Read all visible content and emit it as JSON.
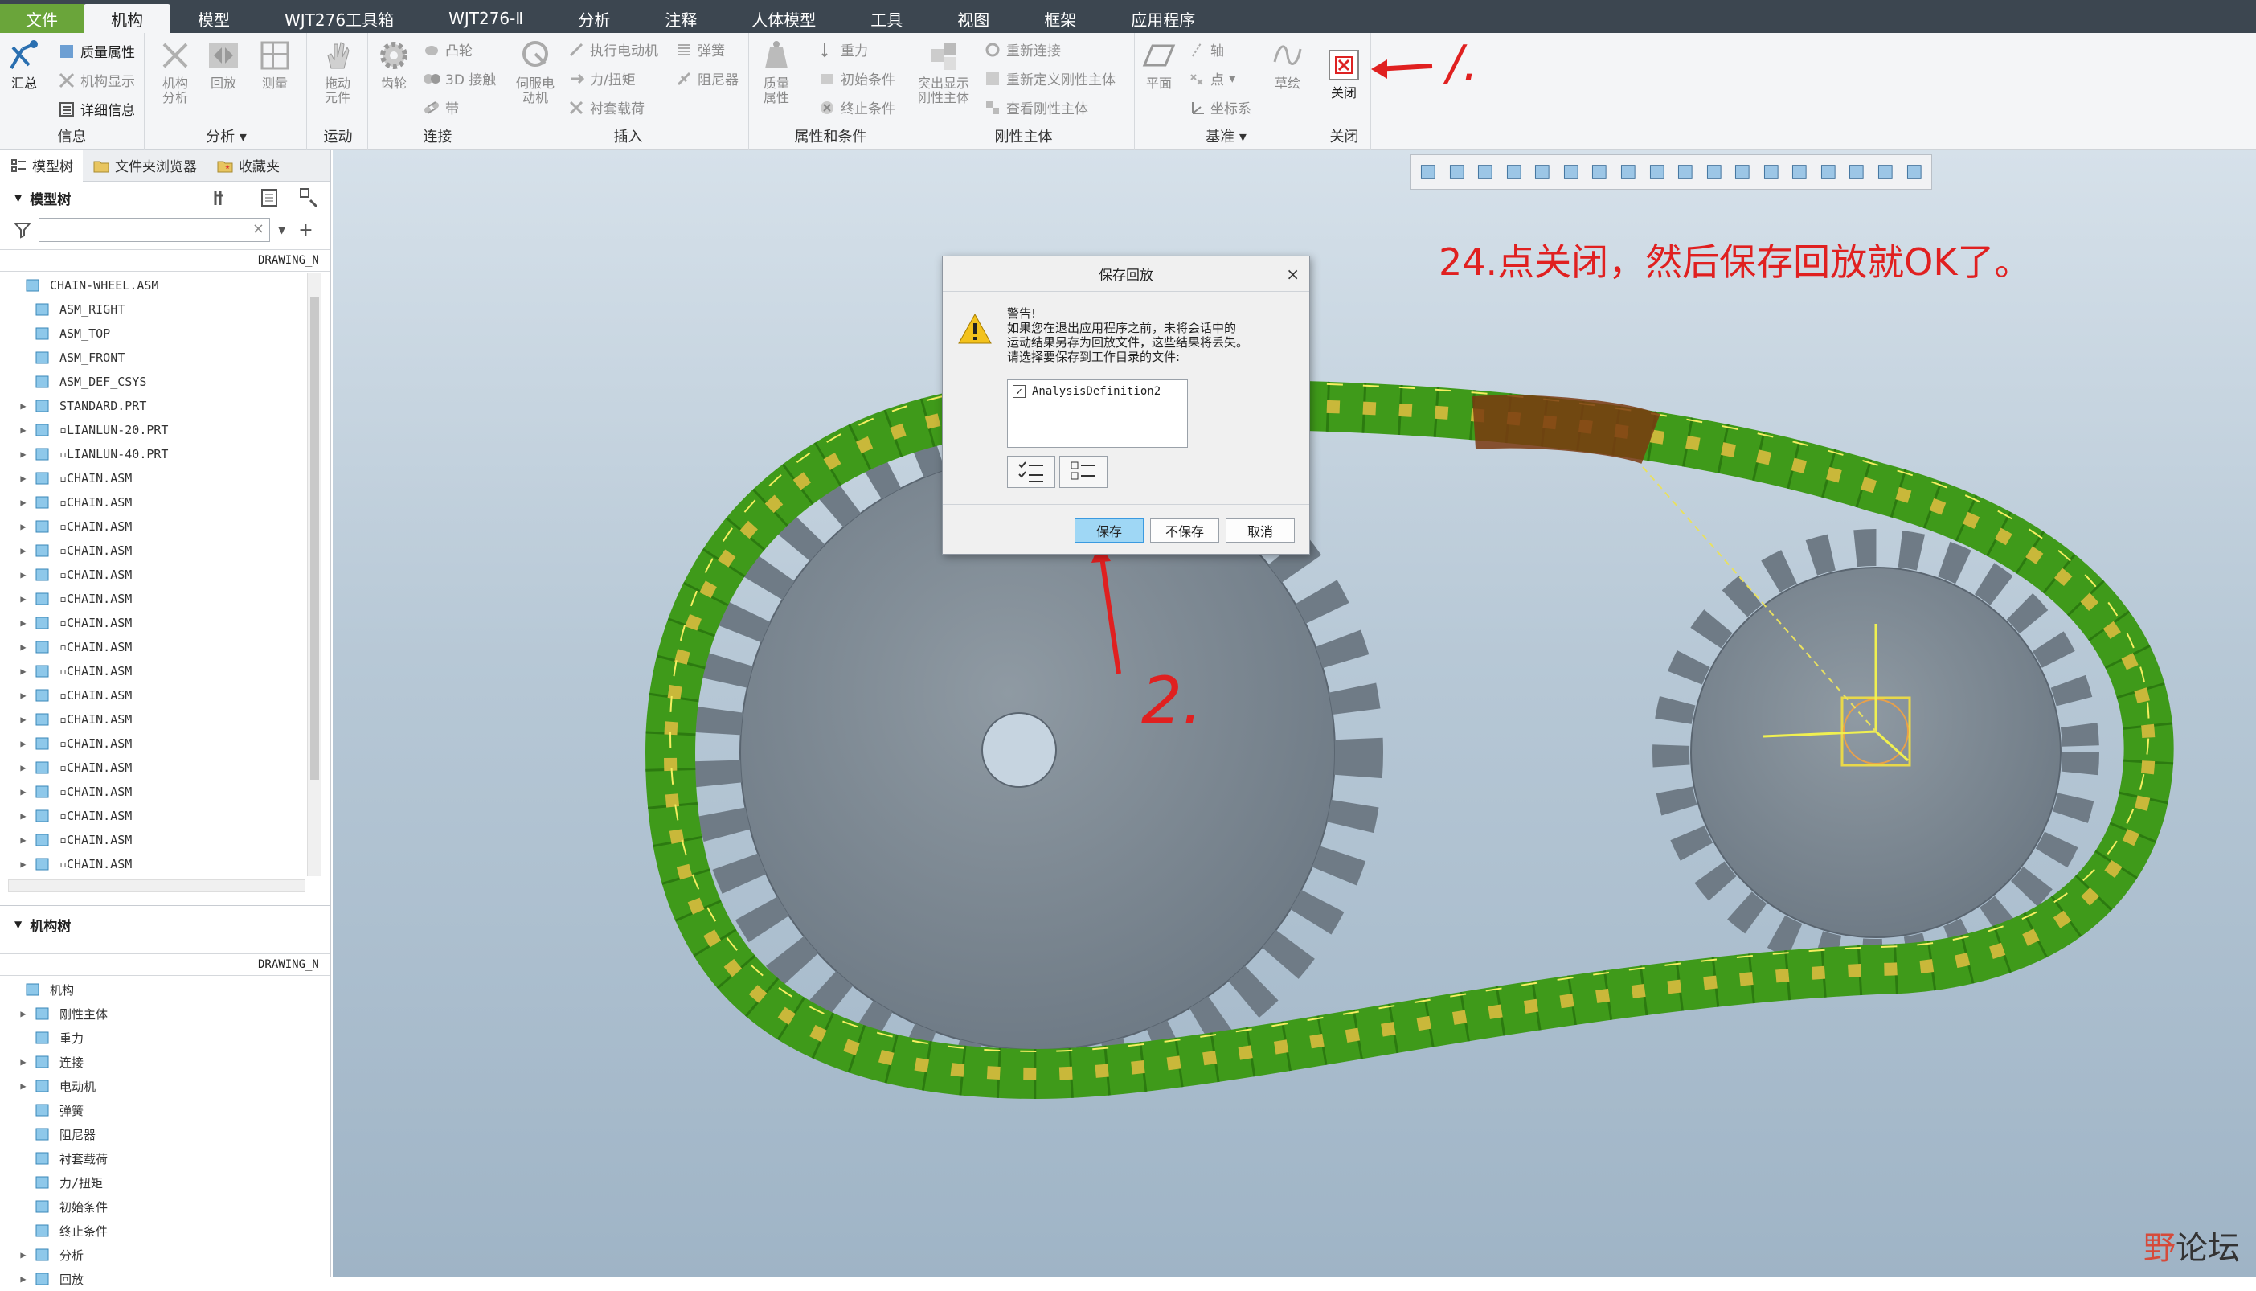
{
  "menubar": {
    "tabs": [
      "文件",
      "机构",
      "模型",
      "WJT276工具箱",
      "WJT276-Ⅱ",
      "分析",
      "注释",
      "人体模型",
      "工具",
      "视图",
      "框架",
      "应用程序"
    ],
    "active_tab": "机构"
  },
  "ribbon": {
    "info": {
      "label": "信息",
      "summary": "汇总",
      "mass_props": "质量属性",
      "mech_display": "机构显示",
      "details": "详细信息"
    },
    "analysis": {
      "label": "分析",
      "mech_analysis": "机构\n分析",
      "playback": "回放",
      "measure": "测量"
    },
    "motion": {
      "label": "运动",
      "drag": "拖动\n元件"
    },
    "connection": {
      "label": "连接",
      "gear": "齿轮",
      "cam": "凸轮",
      "contact3d": "3D 接触",
      "belt": "带"
    },
    "insert": {
      "label": "插入",
      "servo": "伺服电\n动机",
      "exec_motor": "执行电动机",
      "force_torque": "力/扭矩",
      "bushing": "衬套载荷",
      "spring": "弹簧",
      "damper": "阻尼器"
    },
    "properties": {
      "label": "属性和条件",
      "mass_props": "质量\n属性",
      "gravity": "重力",
      "init_cond": "初始条件",
      "term_cond": "终止条件"
    },
    "rigid": {
      "label": "刚性主体",
      "highlight": "突出显示\n刚性主体",
      "reconnect": "重新连接",
      "redefine": "重新定义刚性主体",
      "view": "查看刚性主体"
    },
    "datum": {
      "label": "基准",
      "plane": "平面",
      "axis": "轴",
      "point": "点",
      "csys": "坐标系",
      "sketch": "草绘"
    },
    "close": {
      "label": "关闭",
      "button": "关闭"
    }
  },
  "left_panel": {
    "tabs": [
      "模型树",
      "文件夹浏览器",
      "收藏夹"
    ],
    "model_tree_title": "模型树",
    "column_header": "DRAWING_N",
    "search_placeholder": "",
    "model_tree_items": [
      {
        "label": "CHAIN-WHEEL.ASM",
        "expand": "",
        "indent": 0
      },
      {
        "label": "ASM_RIGHT",
        "expand": "",
        "indent": 1
      },
      {
        "label": "ASM_TOP",
        "expand": "",
        "indent": 1
      },
      {
        "label": "ASM_FRONT",
        "expand": "",
        "indent": 1
      },
      {
        "label": "ASM_DEF_CSYS",
        "expand": "",
        "indent": 1
      },
      {
        "label": "STANDARD.PRT",
        "expand": "▶",
        "indent": 1
      },
      {
        "label": "▫LIANLUN-20.PRT",
        "expand": "▶",
        "indent": 1
      },
      {
        "label": "▫LIANLUN-40.PRT",
        "expand": "▶",
        "indent": 1
      },
      {
        "label": "▫CHAIN.ASM",
        "expand": "▶",
        "indent": 1
      },
      {
        "label": "▫CHAIN.ASM",
        "expand": "▶",
        "indent": 1
      },
      {
        "label": "▫CHAIN.ASM",
        "expand": "▶",
        "indent": 1
      },
      {
        "label": "▫CHAIN.ASM",
        "expand": "▶",
        "indent": 1
      },
      {
        "label": "▫CHAIN.ASM",
        "expand": "▶",
        "indent": 1
      },
      {
        "label": "▫CHAIN.ASM",
        "expand": "▶",
        "indent": 1
      },
      {
        "label": "▫CHAIN.ASM",
        "expand": "▶",
        "indent": 1
      },
      {
        "label": "▫CHAIN.ASM",
        "expand": "▶",
        "indent": 1
      },
      {
        "label": "▫CHAIN.ASM",
        "expand": "▶",
        "indent": 1
      },
      {
        "label": "▫CHAIN.ASM",
        "expand": "▶",
        "indent": 1
      },
      {
        "label": "▫CHAIN.ASM",
        "expand": "▶",
        "indent": 1
      },
      {
        "label": "▫CHAIN.ASM",
        "expand": "▶",
        "indent": 1
      },
      {
        "label": "▫CHAIN.ASM",
        "expand": "▶",
        "indent": 1
      },
      {
        "label": "▫CHAIN.ASM",
        "expand": "▶",
        "indent": 1
      },
      {
        "label": "▫CHAIN.ASM",
        "expand": "▶",
        "indent": 1
      },
      {
        "label": "▫CHAIN.ASM",
        "expand": "▶",
        "indent": 1
      },
      {
        "label": "▫CHAIN.ASM",
        "expand": "▶",
        "indent": 1
      }
    ],
    "mech_tree_title": "机构树",
    "mech_column_header": "DRAWING_N",
    "mech_tree_items": [
      {
        "label": "机构",
        "expand": "",
        "indent": 0
      },
      {
        "label": "刚性主体",
        "expand": "▶",
        "indent": 1
      },
      {
        "label": "重力",
        "expand": "",
        "indent": 1
      },
      {
        "label": "连接",
        "expand": "▶",
        "indent": 1
      },
      {
        "label": "电动机",
        "expand": "▶",
        "indent": 1
      },
      {
        "label": "弹簧",
        "expand": "",
        "indent": 1
      },
      {
        "label": "阻尼器",
        "expand": "",
        "indent": 1
      },
      {
        "label": "衬套载荷",
        "expand": "",
        "indent": 1
      },
      {
        "label": "力/扭矩",
        "expand": "",
        "indent": 1
      },
      {
        "label": "初始条件",
        "expand": "",
        "indent": 1
      },
      {
        "label": "终止条件",
        "expand": "",
        "indent": 1
      },
      {
        "label": "分析",
        "expand": "▶",
        "indent": 1
      },
      {
        "label": "回放",
        "expand": "▶",
        "indent": 1
      }
    ]
  },
  "dialog": {
    "title": "保存回放",
    "warning_title": "警告!",
    "warning_line1": "如果您在退出应用程序之前，未将会话中的",
    "warning_line2": "运动结果另存为回放文件，这些结果将丢失。",
    "warning_line3": "请选择要保存到工作目录的文件:",
    "list_item": "AnalysisDefinition2",
    "list_item_checked": "✓",
    "save": "保存",
    "dont_save": "不保存",
    "cancel": "取消"
  },
  "annotations": {
    "step1": "/.",
    "step2": "2.",
    "instruction": "24.点关闭，然后保存回放就OK了。"
  },
  "watermark": {
    "part1": "野",
    "part2": "论坛"
  },
  "colors": {
    "chain_green": "#3f9a1a",
    "annotation_red": "#e02020",
    "file_tab": "#6aa53a",
    "menubar": "#3c4650"
  }
}
